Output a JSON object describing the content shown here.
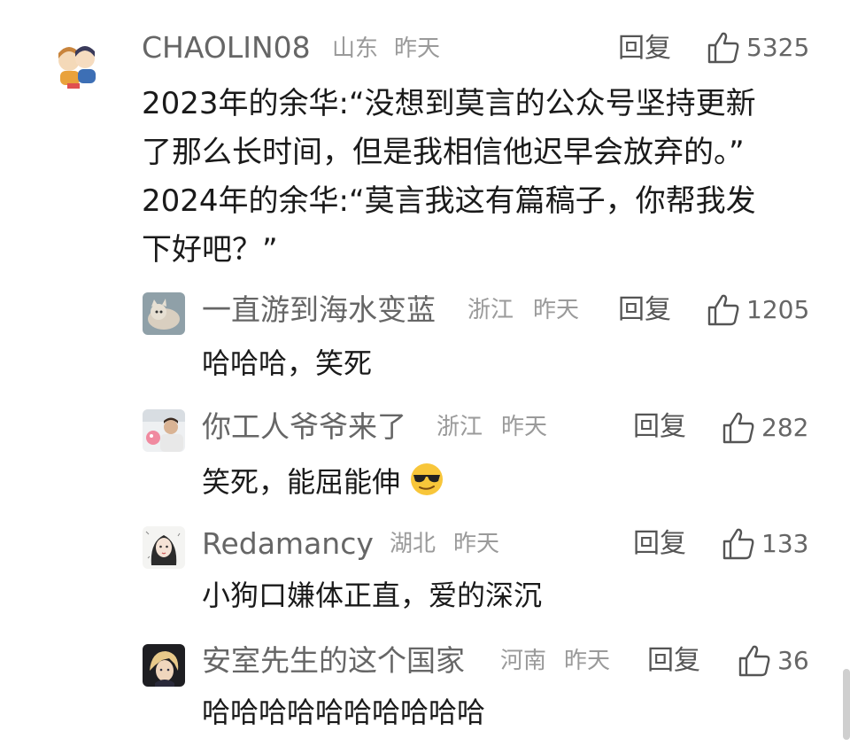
{
  "comments": [
    {
      "username": "CHAOLIN08",
      "location": "山东",
      "time": "昨天",
      "reply": "回复",
      "likes": "5325",
      "avatar_icon": "anime-boy-girl-avatar",
      "lines": [
        "2023年的余华:“没想到莫言的公众号坚持更新",
        "了那么长时间，但是我相信他迟早会放弃的。”",
        "2024年的余华:“莫言我这有篇稿子，你帮我发",
        "下好吧？”"
      ]
    },
    {
      "username": "一直游到海水变蓝",
      "location": "浙江",
      "time": "昨天",
      "reply": "回复",
      "likes": "1205",
      "avatar_icon": "cat-photo-avatar",
      "text": "哈哈哈，笑死"
    },
    {
      "username": "你工人爷爷来了",
      "location": "浙江",
      "time": "昨天",
      "reply": "回复",
      "likes": "282",
      "avatar_icon": "person-photo-avatar",
      "text": "笑死，能屈能伸",
      "emoji": "sunglasses-emoji"
    },
    {
      "username": "Redamancy",
      "location": "湖北",
      "time": "昨天",
      "reply": "回复",
      "likes": "133",
      "avatar_icon": "girl-illustration-avatar",
      "text": "小狗口嫌体正直，爱的深沉"
    },
    {
      "username": "安室先生的这个国家",
      "location": "河南",
      "time": "昨天",
      "reply": "回复",
      "likes": "36",
      "avatar_icon": "anime-character-avatar",
      "text": "哈哈哈哈哈哈哈哈哈哈"
    }
  ],
  "colors": {
    "username": "#666666",
    "meta": "#9a9a9a",
    "body": "#1a1a1a",
    "reply": "#555555"
  }
}
